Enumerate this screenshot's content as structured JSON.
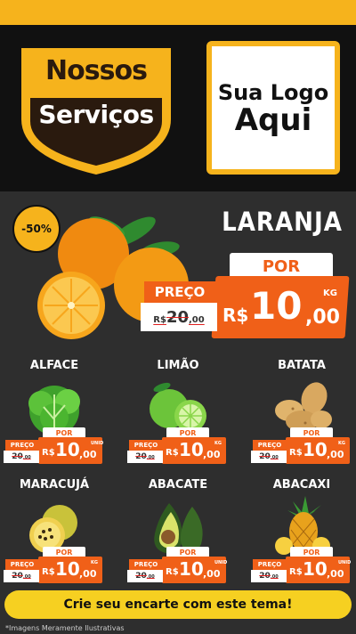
{
  "header": {
    "badge_line1": "Nossos",
    "badge_line2": "Serviços",
    "logo_line1": "Sua Logo",
    "logo_line2": "Aqui"
  },
  "featured": {
    "discount": "-50%",
    "name": "LARANJA",
    "por_label": "POR",
    "preco_label": "PREÇO",
    "old_currency": "R$",
    "old_int": "20",
    "old_dec": ",00",
    "currency": "R$",
    "price_int": "10",
    "price_dec": ",00",
    "unit": "KG"
  },
  "products": [
    {
      "name": "ALFACE",
      "unit": "UNID",
      "icon": "lettuce-icon"
    },
    {
      "name": "LIMÃO",
      "unit": "KG",
      "icon": "lime-icon"
    },
    {
      "name": "BATATA",
      "unit": "KG",
      "icon": "potato-icon"
    },
    {
      "name": "MARACUJÁ",
      "unit": "KG",
      "icon": "passionfruit-icon"
    },
    {
      "name": "ABACATE",
      "unit": "UNID",
      "icon": "avocado-icon"
    },
    {
      "name": "ABACAXI",
      "unit": "UNID",
      "icon": "pineapple-icon"
    }
  ],
  "card_labels": {
    "preco": "PREÇO",
    "por": "POR",
    "old_int": "20",
    "old_dec": ",00",
    "currency": "R$",
    "price_int": "10",
    "price_dec": ",00"
  },
  "cta": "Crie seu encarte com este tema!",
  "disclaimer": "*Imagens Meramente Ilustrativas",
  "colors": {
    "accent_yellow": "#f6b31c",
    "price_orange": "#f06018",
    "background": "#2e2e2e"
  }
}
